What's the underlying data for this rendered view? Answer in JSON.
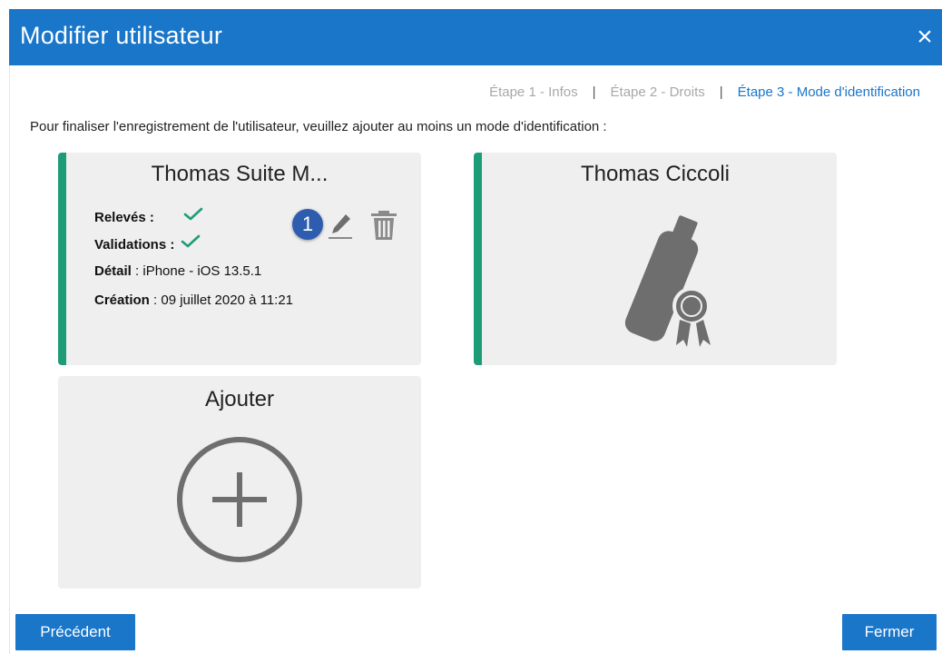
{
  "dialog": {
    "title": "Modifier utilisateur",
    "close_symbol": "×"
  },
  "steps": [
    {
      "label": "Étape 1 - Infos",
      "active": false
    },
    {
      "label": "Étape 2 - Droits",
      "active": false
    },
    {
      "label": "Étape 3 - Mode d'identification",
      "active": true
    }
  ],
  "step_separator": "|",
  "intro_text": "Pour finaliser l'enregistrement de l'utilisateur, veuillez ajouter au moins un mode d'identification :",
  "cards": {
    "phone": {
      "title": "Thomas Suite M...",
      "releves_label": "Relevés :",
      "validations_label": "Validations :",
      "detail_label": "Détail",
      "detail_value": " : iPhone - iOS 13.5.1",
      "creation_label": "Création",
      "creation_value": " : 09 juillet 2020 à 11:21",
      "badge_number": "1"
    },
    "usb": {
      "title": "Thomas Ciccoli"
    },
    "add": {
      "title": "Ajouter"
    }
  },
  "footer": {
    "previous_label": "Précédent",
    "close_label": "Fermer"
  },
  "colors": {
    "primary": "#1976c9",
    "accent_green": "#1e9c78",
    "card_bg": "#efefef",
    "icon_gray": "#6e6e6e"
  }
}
